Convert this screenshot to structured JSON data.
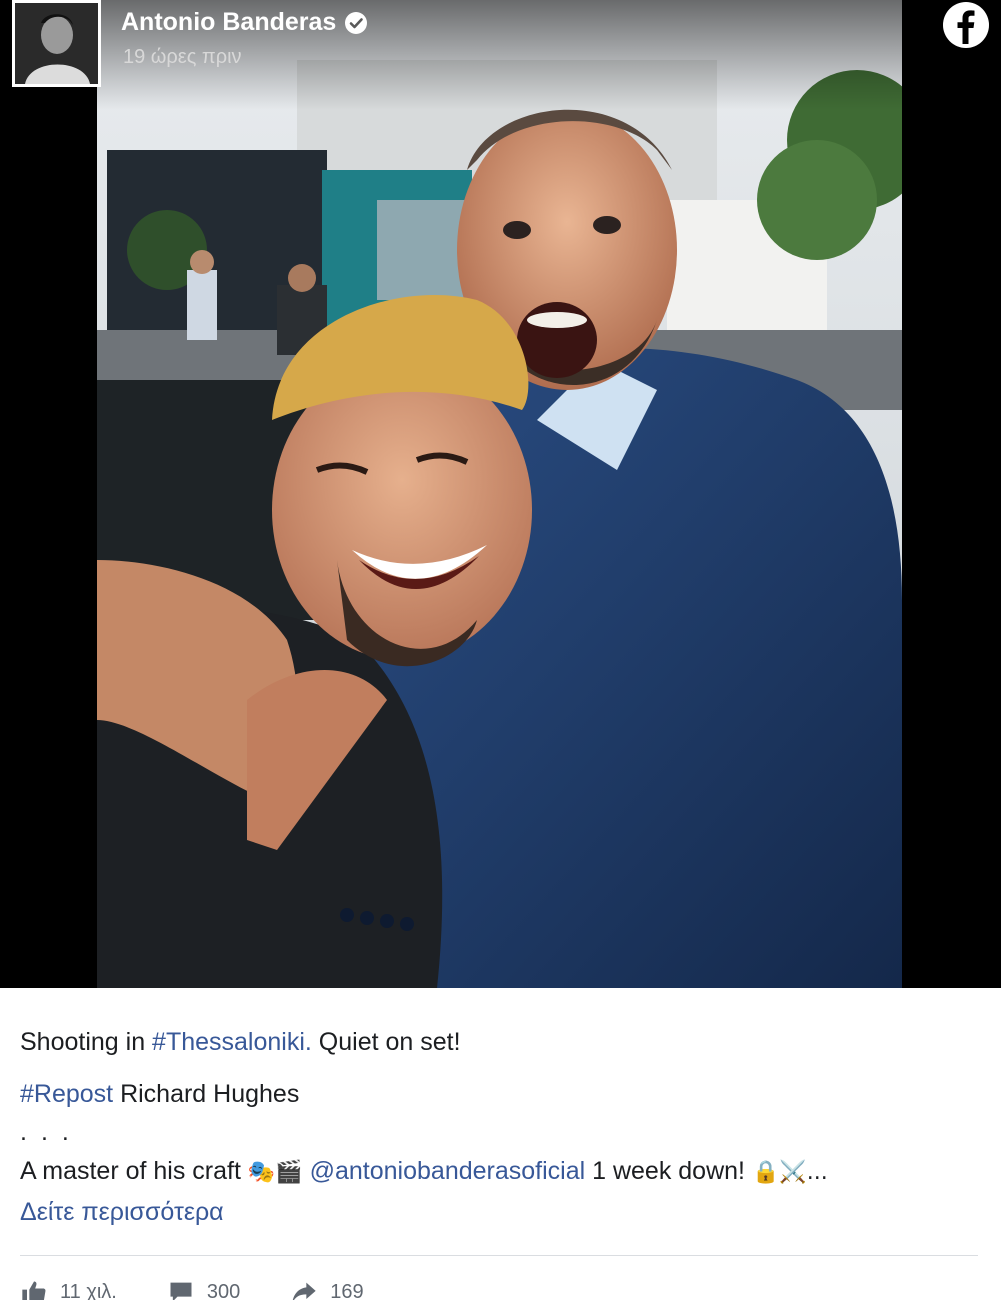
{
  "post": {
    "author": "Antonio Banderas",
    "time": "19 ώρες πριν",
    "line1_prefix": "Shooting in ",
    "line1_hashtag": "#Thessaloniki.",
    "line1_suffix": " Quiet on set!",
    "line2_hashtag": "#Repost",
    "line2_suffix": " Richard Hughes",
    "dots": "...",
    "line4_prefix": "A master of his craft ",
    "line4_emoji1": "🎭🎬",
    "line4_mention": "@antoniobanderasoficial",
    "line4_suffix": " 1 week down! ",
    "line4_emoji2": "🔒⚔️...",
    "see_more": "Δείτε περισσότερα"
  },
  "actions": {
    "likes": "11 χιλ.",
    "comments": "300",
    "shares": "169"
  },
  "colors": {
    "link": "#385898",
    "text": "#1c1e21",
    "divider": "#dadde1"
  },
  "icons": [
    "verified-badge-icon",
    "facebook-logo-icon",
    "like-icon",
    "comment-icon",
    "share-icon"
  ]
}
